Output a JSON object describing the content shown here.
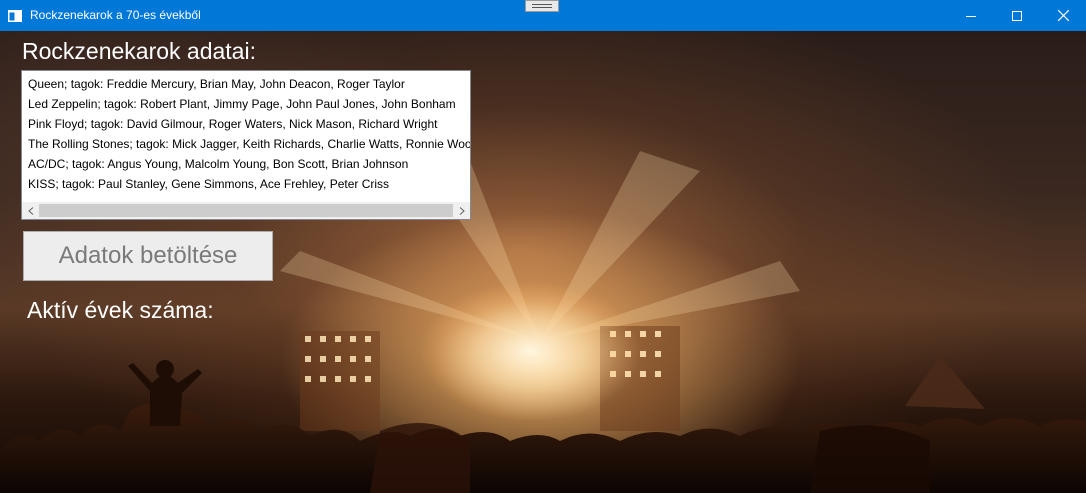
{
  "window": {
    "title": "Rockzenekarok a 70-es évekből",
    "accent_color": "#0078d7",
    "icons": [
      "app-icon",
      "minimize-icon",
      "maximize-icon",
      "close-icon"
    ]
  },
  "main": {
    "heading": "Rockzenekarok adatai:",
    "bands": [
      "Queen; tagok: Freddie Mercury, Brian May, John Deacon, Roger Taylor",
      "Led Zeppelin; tagok: Robert Plant, Jimmy Page, John Paul Jones, John Bonham",
      "Pink Floyd; tagok: David Gilmour, Roger Waters, Nick Mason, Richard Wright",
      "The Rolling Stones; tagok: Mick Jagger, Keith Richards, Charlie Watts, Ronnie Wood",
      "AC/DC; tagok: Angus Young, Malcolm Young, Bon Scott, Brian Johnson",
      "KISS; tagok: Paul Stanley, Gene Simmons, Ace Frehley, Peter Criss"
    ],
    "load_button_label": "Adatok betöltése",
    "active_years_label": "Aktív évek száma:"
  }
}
